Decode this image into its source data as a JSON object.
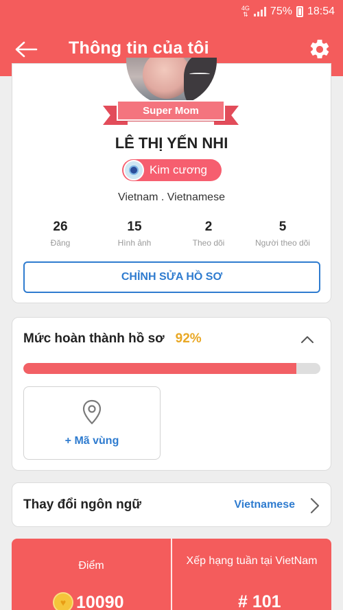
{
  "status_bar": {
    "network": "4G",
    "battery": "75%",
    "time": "18:54"
  },
  "header": {
    "title": "Thông tin của tôi",
    "back_icon": "arrow-left-icon",
    "settings_icon": "gear-icon"
  },
  "profile": {
    "ribbon": "Super Mom",
    "name": "LÊ THỊ YẾN NHI",
    "rank_badge": "Kim cương",
    "location": "Vietnam . Vietnamese",
    "stats": [
      {
        "value": "26",
        "label": "Đăng"
      },
      {
        "value": "15",
        "label": "Hình ảnh"
      },
      {
        "value": "2",
        "label": "Theo dõi"
      },
      {
        "value": "5",
        "label": "Người theo dõi"
      }
    ],
    "edit_button": "CHỈNH SỬA HỒ SƠ"
  },
  "completion": {
    "label": "Mức hoàn thành hồ sơ",
    "percent_text": "92%",
    "progress": 0.92,
    "region_tile": "+ Mã vùng"
  },
  "language": {
    "label": "Thay đổi ngôn ngữ",
    "value": "Vietnamese"
  },
  "summary": {
    "points_label": "Điểm",
    "points_value": "10090",
    "rank_label": "Xếp hạng tuần tại VietNam",
    "rank_value": "# 101"
  },
  "colors": {
    "brand_red": "#f45c5c",
    "link_blue": "#2e7bcf",
    "percent_orange": "#e9a825"
  }
}
